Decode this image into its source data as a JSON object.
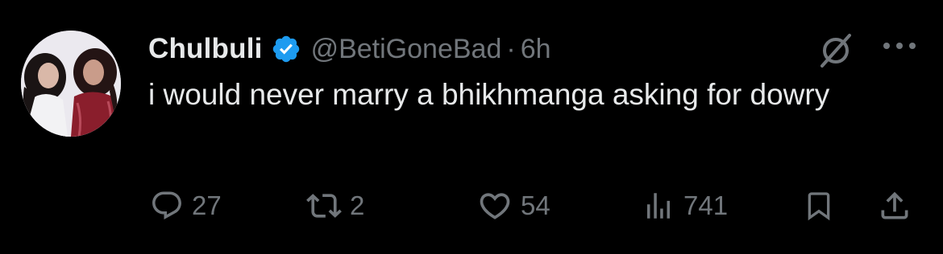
{
  "tweet": {
    "author": {
      "display_name": "Chulbuli",
      "handle": "@BetiGoneBad",
      "separator": "·",
      "time": "6h",
      "verified_color": "#1d9bf0"
    },
    "text": "i would never marry a bhikhmanga asking for dowry",
    "actions": {
      "reply_count": "27",
      "repost_count": "2",
      "like_count": "54",
      "views_count": "741"
    }
  },
  "icons": {
    "verified": "verified-badge-icon",
    "grok": "grok-icon",
    "more": "more-options-icon",
    "reply": "reply-icon",
    "repost": "repost-icon",
    "like": "heart-icon",
    "views": "analytics-icon",
    "bookmark": "bookmark-icon",
    "share": "share-icon"
  },
  "colors": {
    "background": "#000000",
    "primary_text": "#e7e9ea",
    "secondary_text": "#71767b",
    "brand_blue": "#1d9bf0"
  }
}
